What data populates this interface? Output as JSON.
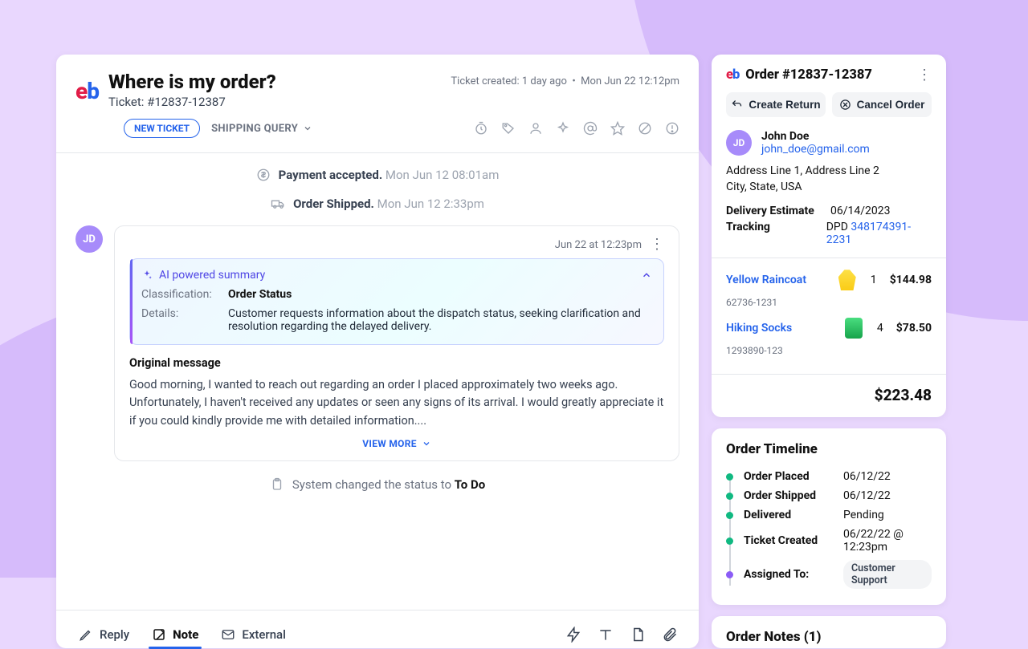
{
  "ticket": {
    "title": "Where is my order?",
    "id_line": "Ticket: #12837-12387",
    "created_rel": "Ticket created: 1 day ago",
    "created_abs": "Mon Jun 22 12:12pm",
    "new_ticket_pill": "NEW TICKET",
    "category": "SHIPPING QUERY"
  },
  "events": {
    "payment": {
      "label": "Payment accepted.",
      "time": "Mon Jun 12 08:01am"
    },
    "shipped": {
      "label": "Order Shipped.",
      "time": "Mon Jun 12 2:33pm"
    },
    "status_prefix": "System changed the status to ",
    "status_value": "To Do"
  },
  "message": {
    "avatar": "JD",
    "timestamp": "Jun 22 at 12:23pm",
    "ai_header": "AI powered summary",
    "classification_key": "Classification:",
    "classification_val": "Order Status",
    "details_key": "Details:",
    "details_val": "Customer requests information about the dispatch status, seeking clarification and resolution regarding the delayed delivery.",
    "orig_title": "Original message",
    "orig_body": "Good morning, I wanted to reach out regarding an order I placed approximately two weeks ago. Unfortunately, I haven't received any updates or seen any signs of its arrival. I would greatly appreciate it if you could kindly provide me with detailed information....",
    "view_more": "VIEW MORE"
  },
  "composer": {
    "reply": "Reply",
    "note": "Note",
    "external": "External"
  },
  "order": {
    "title": "Order #12837-12387",
    "create_return": "Create Return",
    "cancel_order": "Cancel Order",
    "customer": {
      "initials": "JD",
      "name": "John Doe",
      "email": "john_doe@gmail.com"
    },
    "address_l1": "Address Line 1, Address Line 2",
    "address_l2": "City, State, USA",
    "delivery_k": "Delivery Estimate",
    "delivery_v": "06/14/2023",
    "tracking_k": "Tracking",
    "tracking_carrier": "DPD ",
    "tracking_num": "348174391-2231",
    "items": [
      {
        "name": "Yellow Raincoat",
        "sku": "62736-1231",
        "qty": "1",
        "price": "$144.98",
        "thumb": "yellow"
      },
      {
        "name": "Hiking Socks",
        "sku": "1293890-123",
        "qty": "4",
        "price": "$78.50",
        "thumb": "green"
      }
    ],
    "total": "$223.48"
  },
  "timeline": {
    "title": "Order Timeline",
    "rows": [
      {
        "k": "Order Placed",
        "v": "06/12/22",
        "color": "green"
      },
      {
        "k": "Order Shipped",
        "v": "06/12/22",
        "color": "green"
      },
      {
        "k": "Delivered",
        "v": "Pending",
        "color": "green"
      },
      {
        "k": "Ticket Created",
        "v": "06/22/22 @ 12:23pm",
        "color": "green"
      },
      {
        "k": "Assigned To:",
        "v": "Customer Support",
        "color": "purple",
        "badge": true
      }
    ]
  },
  "notes": {
    "title": "Order Notes (1)"
  }
}
